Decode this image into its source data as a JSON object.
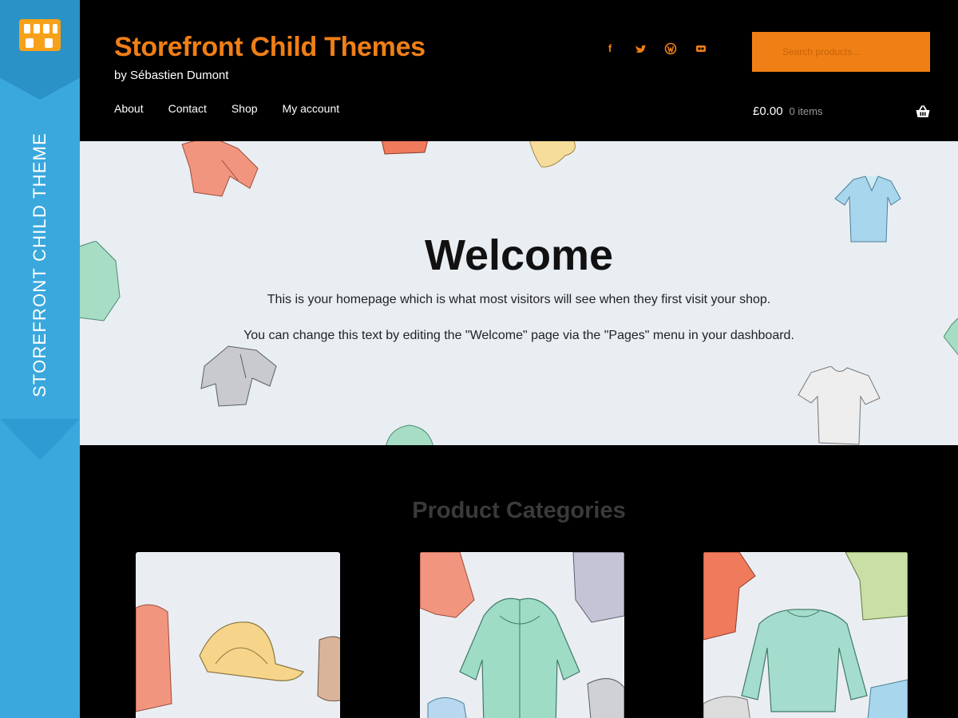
{
  "ribbon": {
    "label": "STOREFRONT CHILD THEME",
    "logo_icon": "storefront-awning-icon",
    "colors": {
      "primary": "#3aa8dd",
      "dark": "#2a92c7"
    }
  },
  "header": {
    "site_title": "Storefront Child Themes",
    "site_description": "by Sébastien Dumont",
    "social_icons": [
      "facebook-icon",
      "twitter-icon",
      "wordpress-icon",
      "flickr-icon"
    ],
    "search": {
      "placeholder": "Search products…"
    },
    "nav": [
      {
        "label": "About"
      },
      {
        "label": "Contact"
      },
      {
        "label": "Shop"
      },
      {
        "label": "My account"
      }
    ],
    "cart": {
      "amount": "£0.00",
      "count": "0 items"
    },
    "accent_color": "#f07f15"
  },
  "hero": {
    "title": "Welcome",
    "paragraph_1": "This is your homepage which is what most visitors will see when they first visit your shop.",
    "paragraph_2": "You can change this text by editing the \"Welcome\" page via the \"Pages\" menu in your dashboard."
  },
  "categories": {
    "heading": "Product Categories"
  }
}
